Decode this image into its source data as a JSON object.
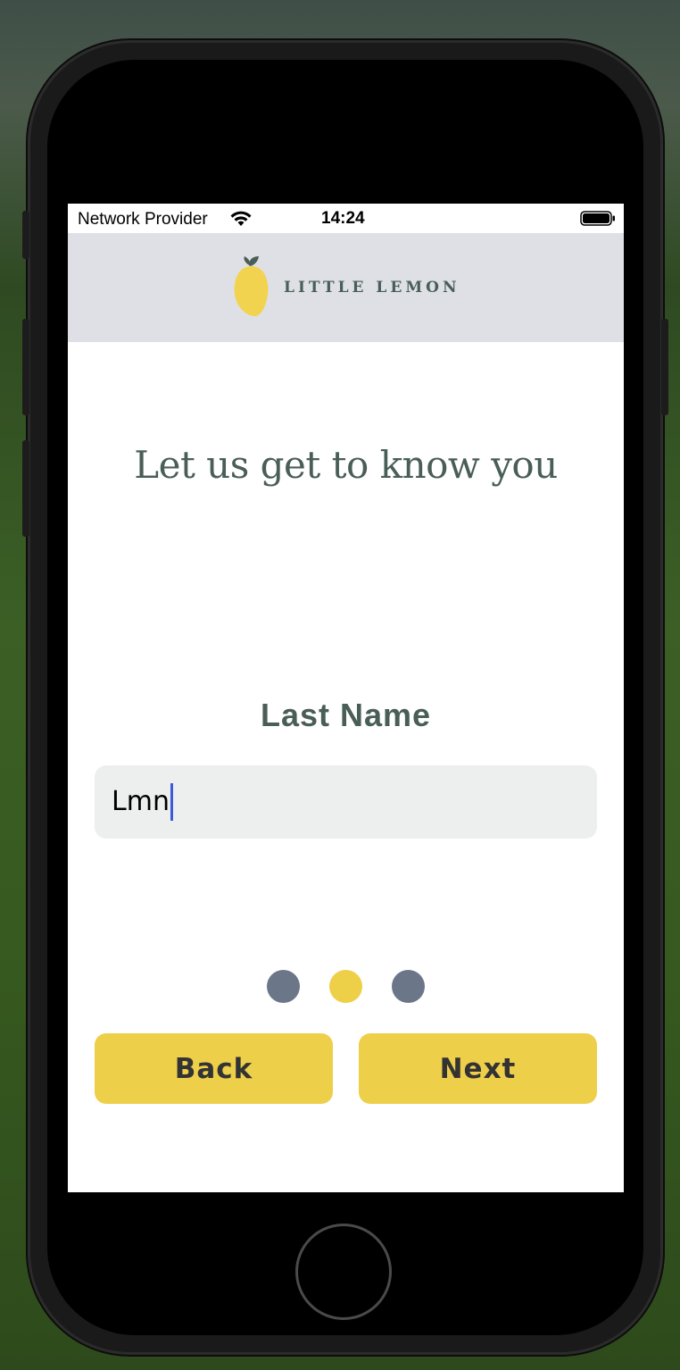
{
  "status_bar": {
    "carrier": "Network Provider",
    "time": "14:24",
    "wifi_icon": "wifi-icon",
    "battery_icon": "battery-full-icon"
  },
  "header": {
    "logo_icon": "lemon-icon",
    "brand": "LITTLE LEMON"
  },
  "onboarding": {
    "title": "Let us get to know you",
    "field_label": "Last Name",
    "field_value": "Lmn",
    "page_indicator": {
      "total": 3,
      "active_index": 1
    },
    "back_label": "Back",
    "next_label": "Next"
  },
  "colors": {
    "brand_green": "#495e57",
    "brand_yellow": "#edcf4a",
    "header_bg": "#dee0e5",
    "input_bg": "#edefee",
    "dot_inactive": "#6c7689",
    "caret": "#3d5bd9"
  }
}
